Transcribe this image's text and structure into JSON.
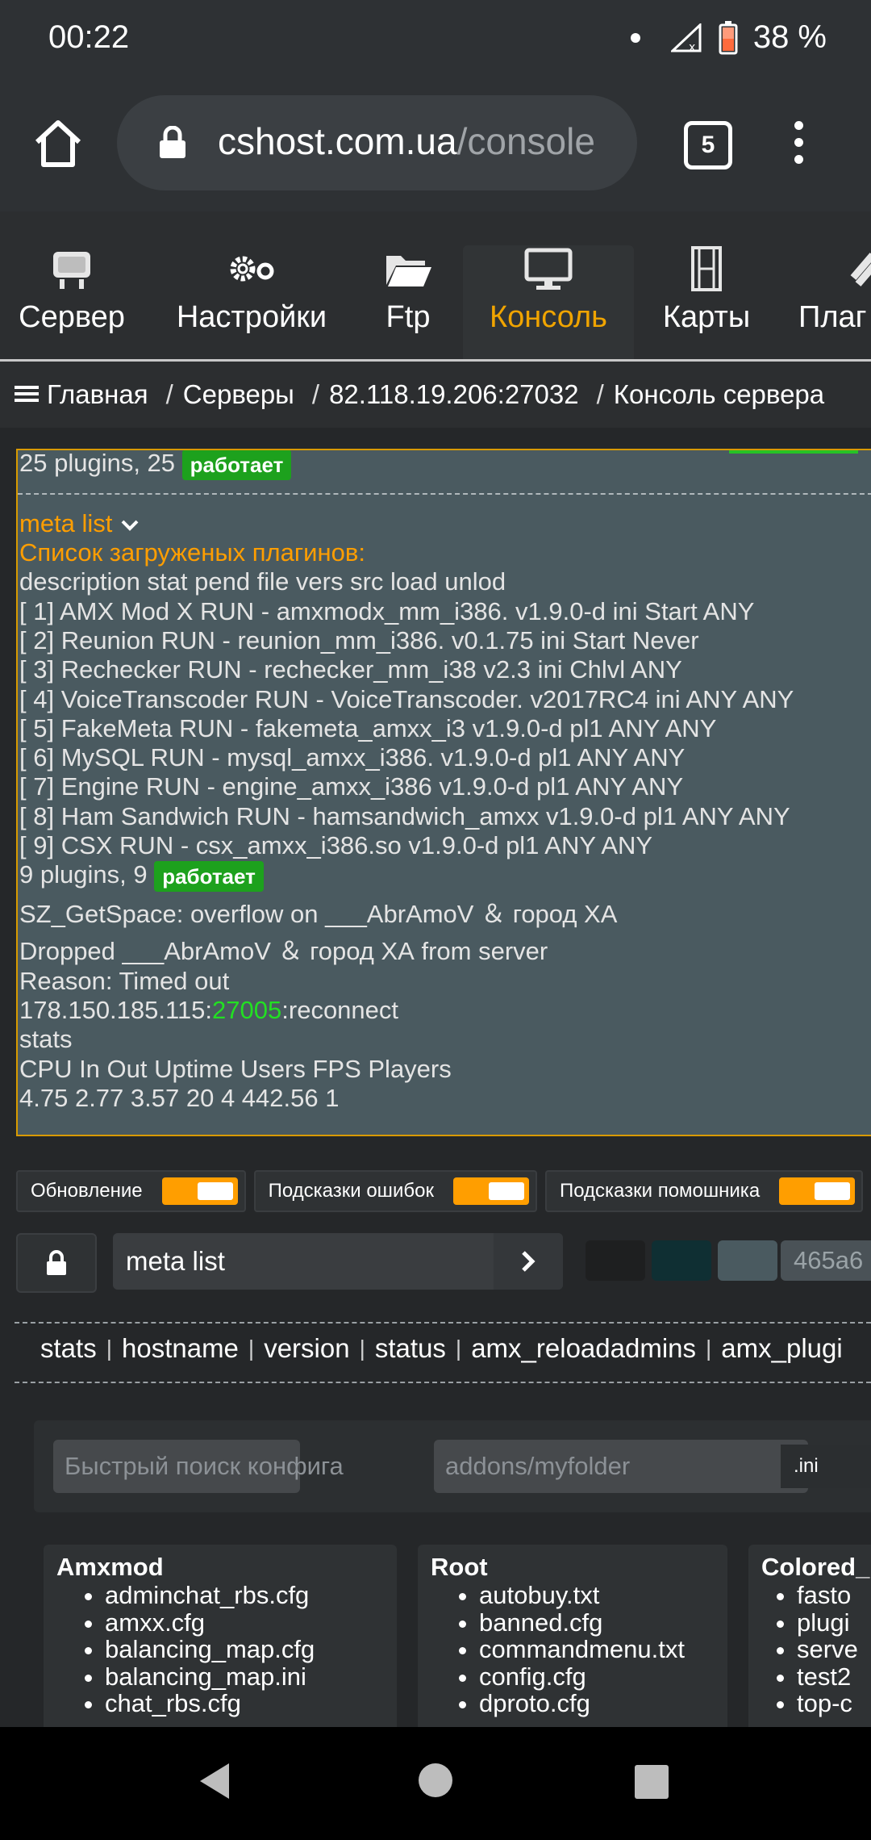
{
  "status_bar": {
    "time": "00:22",
    "battery": "38 %"
  },
  "browser": {
    "url_host": "cshost.com.ua",
    "url_path": "/console",
    "tab_count": "5"
  },
  "nav_tabs": [
    {
      "label": "Сервер"
    },
    {
      "label": "Настройки"
    },
    {
      "label": "Ftp"
    },
    {
      "label": "Консоль"
    },
    {
      "label": "Карты"
    },
    {
      "label": "Плаг"
    }
  ],
  "breadcrumb": [
    "Главная",
    "Серверы",
    "82.118.19.206:27032",
    "Консоль сервера"
  ],
  "console": {
    "first_line": "25 plugins, 25",
    "running_badge": "работает",
    "command": "meta list",
    "plugins_header": "Список загруженых плагинов:",
    "columns": "description stat pend file vers src load unlod",
    "plugins": [
      "[ 1] AMX Mod X RUN - amxmodx_mm_i386. v1.9.0-d ini Start ANY",
      "[ 2] Reunion RUN - reunion_mm_i386. v0.1.75 ini Start Never",
      "[ 3] Rechecker RUN - rechecker_mm_i38 v2.3 ini Chlvl ANY",
      "[ 4] VoiceTranscoder RUN - VoiceTranscoder. v2017RC4 ini ANY ANY",
      "[ 5] FakeMeta RUN - fakemeta_amxx_i3 v1.9.0-d pl1 ANY ANY",
      "[ 6] MySQL RUN - mysql_amxx_i386. v1.9.0-d pl1 ANY ANY",
      "[ 7] Engine RUN - engine_amxx_i386 v1.9.0-d pl1 ANY ANY",
      "[ 8] Ham Sandwich RUN - hamsandwich_amxx v1.9.0-d pl1 ANY ANY",
      "[ 9] CSX RUN - csx_amxx_i386.so v1.9.0-d pl1 ANY ANY"
    ],
    "plugins_summary": "9 plugins, 9",
    "overflow": "SZ_GetSpace: overflow on ___AbrAmoV ＆ город ХА",
    "dropped": "Dropped ___AbrAmoV ＆ город ХА from server",
    "reason": "Reason: Timed out",
    "ip": "178.150.185.115:",
    "port": "27005",
    "reconnect": ":reconnect",
    "stats_cmd": "stats",
    "stats_header": "CPU In Out Uptime Users FPS Players",
    "stats_values": "4.75 2.77 3.57 20 4 442.56 1"
  },
  "toggles": [
    {
      "label": "Обновление",
      "on": true
    },
    {
      "label": "Подсказки ошибок",
      "on": true
    },
    {
      "label": "Подсказки помошника",
      "on": true
    }
  ],
  "command_input": {
    "value": "meta list"
  },
  "color_swatches": [
    "#1e1f20",
    "#0f2f33",
    "#4a5a60"
  ],
  "hex_value": "465a6",
  "quick_commands": [
    "stats",
    "hostname",
    "version",
    "status",
    "amx_reloadadmins",
    "amx_plugi"
  ],
  "config_search": {
    "search_placeholder": "Быстрый поиск конфига",
    "folder_placeholder": "addons/myfolder",
    "ext": ".ini"
  },
  "config_groups": [
    {
      "title": "Amxmod",
      "files": [
        "adminchat_rbs.cfg",
        "amxx.cfg",
        "balancing_map.cfg",
        "balancing_map.ini",
        "chat_rbs.cfg"
      ]
    },
    {
      "title": "Root",
      "files": [
        "autobuy.txt",
        "banned.cfg",
        "commandmenu.txt",
        "config.cfg",
        "dproto.cfg"
      ]
    },
    {
      "title": "Colored_",
      "files": [
        "fasto",
        "plugi",
        "serve",
        "test2",
        "top-c"
      ]
    }
  ]
}
